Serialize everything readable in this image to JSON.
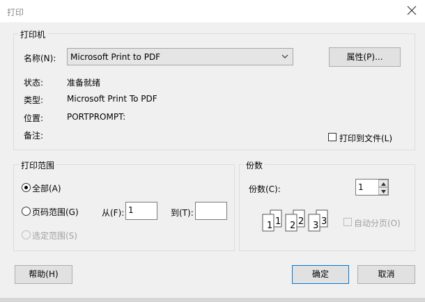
{
  "window": {
    "title": "打印"
  },
  "printer_group": {
    "label": "打印机",
    "name_label": "名称(N):",
    "name_value": "Microsoft Print to PDF",
    "properties_button": "属性(P)...",
    "status_label": "状态:",
    "status_value": "准备就绪",
    "type_label": "类型:",
    "type_value": "Microsoft Print To PDF",
    "where_label": "位置:",
    "where_value": "PORTPROMPT:",
    "comment_label": "备注:",
    "print_to_file_label": "打印到文件(L)"
  },
  "range_group": {
    "label": "打印范围",
    "all_label": "全部(A)",
    "pages_label": "页码范围(G)",
    "from_label": "从(F):",
    "from_value": "1",
    "to_label": "到(T):",
    "to_value": "",
    "selection_label": "选定范围(S)"
  },
  "copies_group": {
    "label": "份数",
    "copies_label": "份数(C):",
    "copies_value": "1",
    "collate_label": "自动分页(O)",
    "collate_pages": [
      "1",
      "1",
      "2",
      "2",
      "3",
      "3"
    ]
  },
  "buttons": {
    "help": "帮助(H)",
    "ok": "确定",
    "cancel": "取消"
  },
  "colors": {
    "focus_border": "#0078d7",
    "disabled_text": "#a0a0a0"
  }
}
